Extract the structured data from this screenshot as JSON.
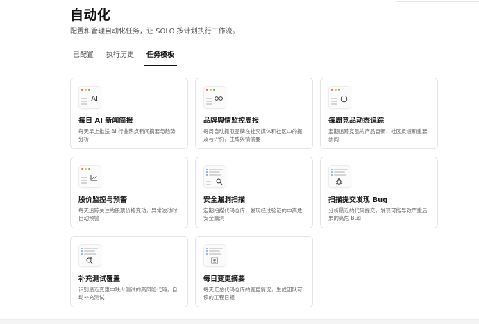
{
  "header": {
    "title": "自动化",
    "subtitle": "配置和管理自动化任务，让 SOLO 按计划执行工作流。"
  },
  "tabs": [
    {
      "label": "已配置",
      "active": false
    },
    {
      "label": "执行历史",
      "active": false
    },
    {
      "label": "任务模板",
      "active": true
    }
  ],
  "colors": {
    "dot_red": "#f06a5b",
    "dot_yellow": "#f5b940",
    "dot_green": "#4cc25c",
    "accent_blue": "#7aa2e3"
  },
  "templates": [
    {
      "title": "每日 AI 新闻简报",
      "desc": "每天早上推送 AI 行业热点新闻摘要与趋势分析",
      "icon": "ai-text-icon",
      "glyph": "AI"
    },
    {
      "title": "品牌舆情监控周报",
      "desc": "每周自动抓取品牌在社交媒体和社区中的提及与评价，生成舆情摘要",
      "icon": "glasses-icon"
    },
    {
      "title": "每周竞品动态追踪",
      "desc": "定期追踪竞品的产品更新、社区反馈和重要新闻",
      "icon": "target-icon"
    },
    {
      "title": "股价监控与预警",
      "desc": "每天追踪关注的股票价格变动，异常波动时自动预警",
      "icon": "trend-chart-icon"
    },
    {
      "title": "安全漏洞扫描",
      "desc": "定期扫描代码仓库，发现经过验证的中高危安全漏洞",
      "icon": "scan-search-icon"
    },
    {
      "title": "扫描提交发现 Bug",
      "desc": "分析最近的代码提交，发现可能导致严重后果的高危 Bug",
      "icon": "bug-icon"
    },
    {
      "title": "补充测试覆盖",
      "desc": "识别最近变更中缺少测试的高风险代码，自动补充测试",
      "icon": "search-check-icon"
    },
    {
      "title": "每日变更摘要",
      "desc": "每天汇总代码仓库的变更情况，生成团队可读的工程日报",
      "icon": "document-icon"
    }
  ]
}
